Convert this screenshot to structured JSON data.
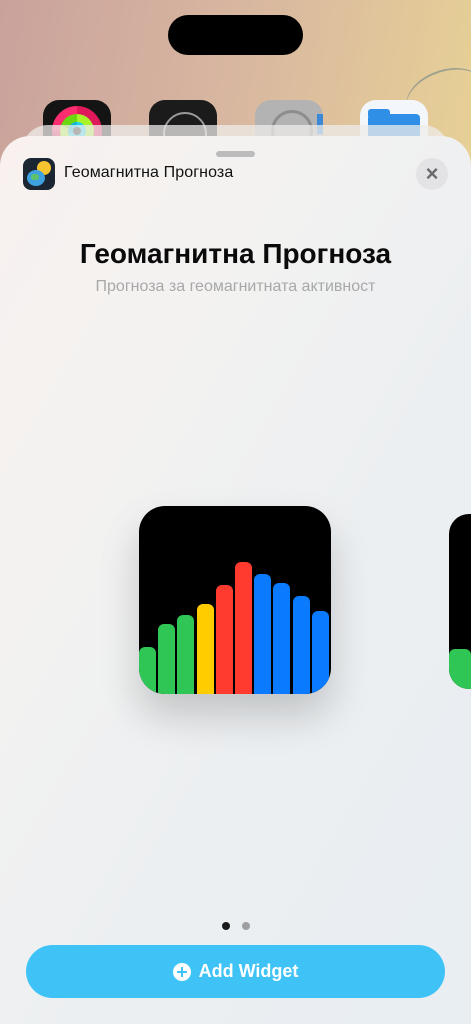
{
  "home": {
    "apps": [
      {
        "name": "activity-app-icon"
      },
      {
        "name": "clock-app-icon"
      },
      {
        "name": "settings-app-icon"
      },
      {
        "name": "files-app-icon"
      }
    ]
  },
  "sheet": {
    "app_name": "Геомагнитна Прогноза",
    "close_icon": "×",
    "title": "Геомагнитна Прогноза",
    "subtitle": "Прогноза за геомагнитната активност",
    "add_button_label": "Add Widget",
    "page_count": 2,
    "current_page": 1
  },
  "widget": {
    "bars": [
      {
        "level": 0.25,
        "color": "#2fc655"
      },
      {
        "level": 0.37,
        "color": "#2fc655"
      },
      {
        "level": 0.42,
        "color": "#2fc655"
      },
      {
        "level": 0.48,
        "color": "#ffcc00"
      },
      {
        "level": 0.58,
        "color": "#ff3b30"
      },
      {
        "level": 0.7,
        "color": "#ff3b30"
      },
      {
        "level": 0.64,
        "color": "#0a7aff"
      },
      {
        "level": 0.59,
        "color": "#0a7aff"
      },
      {
        "level": 0.52,
        "color": "#0a7aff"
      },
      {
        "level": 0.44,
        "color": "#0a7aff"
      }
    ]
  },
  "colors": {
    "accent": "#3fc3f7",
    "green": "#2fc655",
    "yellow": "#ffcc00",
    "red": "#ff3b30",
    "blue": "#0a7aff"
  }
}
